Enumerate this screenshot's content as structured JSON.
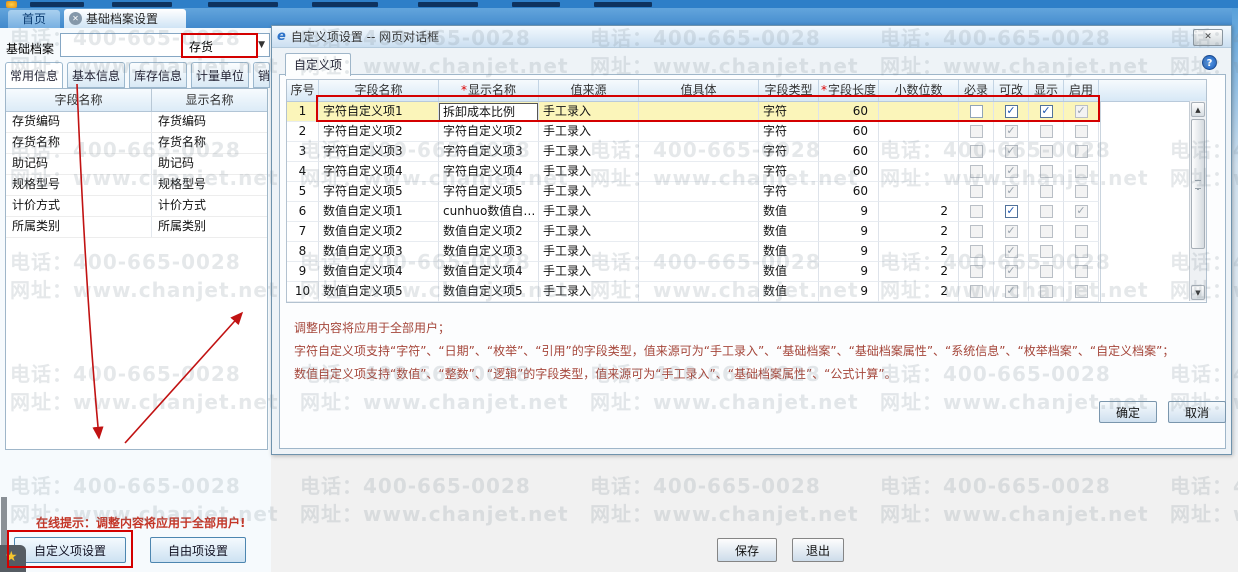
{
  "tab_bar": {
    "home": "首页",
    "active": "基础档案设置"
  },
  "left_panel": {
    "archive_label": "基础档案",
    "archive_value": "存货",
    "tabs": [
      "常用信息",
      "基本信息",
      "库存信息",
      "计量单位"
    ],
    "partial_tab": "销",
    "table": {
      "headers": [
        "字段名称",
        "显示名称"
      ],
      "rows": [
        [
          "存货编码",
          "存货编码"
        ],
        [
          "存货名称",
          "存货名称"
        ],
        [
          "助记码",
          "助记码"
        ],
        [
          "规格型号",
          "规格型号"
        ],
        [
          "计价方式",
          "计价方式"
        ],
        [
          "所属类别",
          "所属类别"
        ]
      ]
    },
    "hint": "在线提示：调整内容将应用于全部用户!",
    "buttons": {
      "custom": "自定义项设置",
      "free": "自由项设置"
    }
  },
  "dialog": {
    "title": "自定义项设置 -- 网页对话框",
    "tab": "自定义项",
    "columns": [
      {
        "label": "序号",
        "required": false
      },
      {
        "label": "字段名称",
        "required": false
      },
      {
        "label": "显示名称",
        "required": true
      },
      {
        "label": "值来源",
        "required": false
      },
      {
        "label": "值具体",
        "required": false
      },
      {
        "label": "字段类型",
        "required": false
      },
      {
        "label": "字段长度",
        "required": true
      },
      {
        "label": "小数位数",
        "required": false
      },
      {
        "label": "必录",
        "required": false
      },
      {
        "label": "可改",
        "required": false
      },
      {
        "label": "显示",
        "required": false
      },
      {
        "label": "启用",
        "required": false
      }
    ],
    "rows": [
      {
        "seq": "1",
        "name": "字符自定义项1",
        "display": "拆卸成本比例",
        "source": "手工录入",
        "detail": "",
        "type": "字符",
        "len": "60",
        "dec": "",
        "checks": [
          "e",
          "bc",
          "bc",
          "dc"
        ],
        "highlight": true,
        "editor": true
      },
      {
        "seq": "2",
        "name": "字符自定义项2",
        "display": "字符自定义项2",
        "source": "手工录入",
        "detail": "",
        "type": "字符",
        "len": "60",
        "dec": "",
        "checks": [
          "d",
          "dc",
          "d",
          "d"
        ]
      },
      {
        "seq": "3",
        "name": "字符自定义项3",
        "display": "字符自定义项3",
        "source": "手工录入",
        "detail": "",
        "type": "字符",
        "len": "60",
        "dec": "",
        "checks": [
          "d",
          "dc",
          "d",
          "d"
        ]
      },
      {
        "seq": "4",
        "name": "字符自定义项4",
        "display": "字符自定义项4",
        "source": "手工录入",
        "detail": "",
        "type": "字符",
        "len": "60",
        "dec": "",
        "checks": [
          "d",
          "dc",
          "d",
          "d"
        ]
      },
      {
        "seq": "5",
        "name": "字符自定义项5",
        "display": "字符自定义项5",
        "source": "手工录入",
        "detail": "",
        "type": "字符",
        "len": "60",
        "dec": "",
        "checks": [
          "d",
          "dc",
          "d",
          "d"
        ]
      },
      {
        "seq": "6",
        "name": "数值自定义项1",
        "display": "cunhuo数值自…",
        "source": "手工录入",
        "detail": "",
        "type": "数值",
        "len": "9",
        "dec": "2",
        "checks": [
          "d",
          "bc",
          "d",
          "dc"
        ]
      },
      {
        "seq": "7",
        "name": "数值自定义项2",
        "display": "数值自定义项2",
        "source": "手工录入",
        "detail": "",
        "type": "数值",
        "len": "9",
        "dec": "2",
        "checks": [
          "d",
          "dc",
          "d",
          "d"
        ]
      },
      {
        "seq": "8",
        "name": "数值自定义项3",
        "display": "数值自定义项3",
        "source": "手工录入",
        "detail": "",
        "type": "数值",
        "len": "9",
        "dec": "2",
        "checks": [
          "d",
          "dc",
          "d",
          "d"
        ]
      },
      {
        "seq": "9",
        "name": "数值自定义项4",
        "display": "数值自定义项4",
        "source": "手工录入",
        "detail": "",
        "type": "数值",
        "len": "9",
        "dec": "2",
        "checks": [
          "d",
          "dc",
          "d",
          "d"
        ]
      },
      {
        "seq": "10",
        "name": "数值自定义项5",
        "display": "数值自定义项5",
        "source": "手工录入",
        "detail": "",
        "type": "数值",
        "len": "9",
        "dec": "2",
        "checks": [
          "d",
          "dc",
          "d",
          "d"
        ]
      }
    ],
    "notes": [
      "调整内容将应用于全部用户；",
      "字符自定义项支持“字符”、“日期”、“枚举”、“引用”的字段类型，值来源可为“手工录入”、“基础档案”、“基础档案属性”、“系统信息”、“枚举档案”、“自定义档案”；",
      "数值自定义项支持“数值”、“整数”、“逻辑”的字段类型，值来源可为“手工录入”、“基础档案属性”、“公式计算”。"
    ],
    "ok_label": "确定",
    "cancel_label": "取消"
  },
  "footer": {
    "save_label": "保存",
    "exit_label": "退出"
  },
  "watermark": {
    "line1": "电话：400-665-0028",
    "line2": "网址：www.chanjet.net"
  }
}
